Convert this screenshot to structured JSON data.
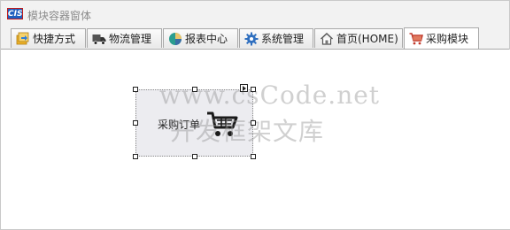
{
  "window": {
    "title": "模块容器窗体",
    "logo_text": "CIS"
  },
  "tabs": [
    {
      "label": "快捷方式",
      "icon": "shortcut-icon"
    },
    {
      "label": "物流管理",
      "icon": "truck-icon"
    },
    {
      "label": "报表中心",
      "icon": "pie-chart-icon"
    },
    {
      "label": "系统管理",
      "icon": "gear-icon"
    },
    {
      "label": "首页(HOME)",
      "icon": "home-icon"
    },
    {
      "label": "采购模块",
      "icon": "shopping-cart-icon",
      "active": true
    }
  ],
  "module": {
    "label": "采购订单",
    "icon": "shopping-cart-icon"
  },
  "watermark": {
    "line1": "www.csCode.net",
    "line2": "开发框架文库"
  },
  "colors": {
    "accent_blue": "#1f5fbf",
    "cart_red": "#c0392b",
    "module_bg": "#ececf0"
  }
}
